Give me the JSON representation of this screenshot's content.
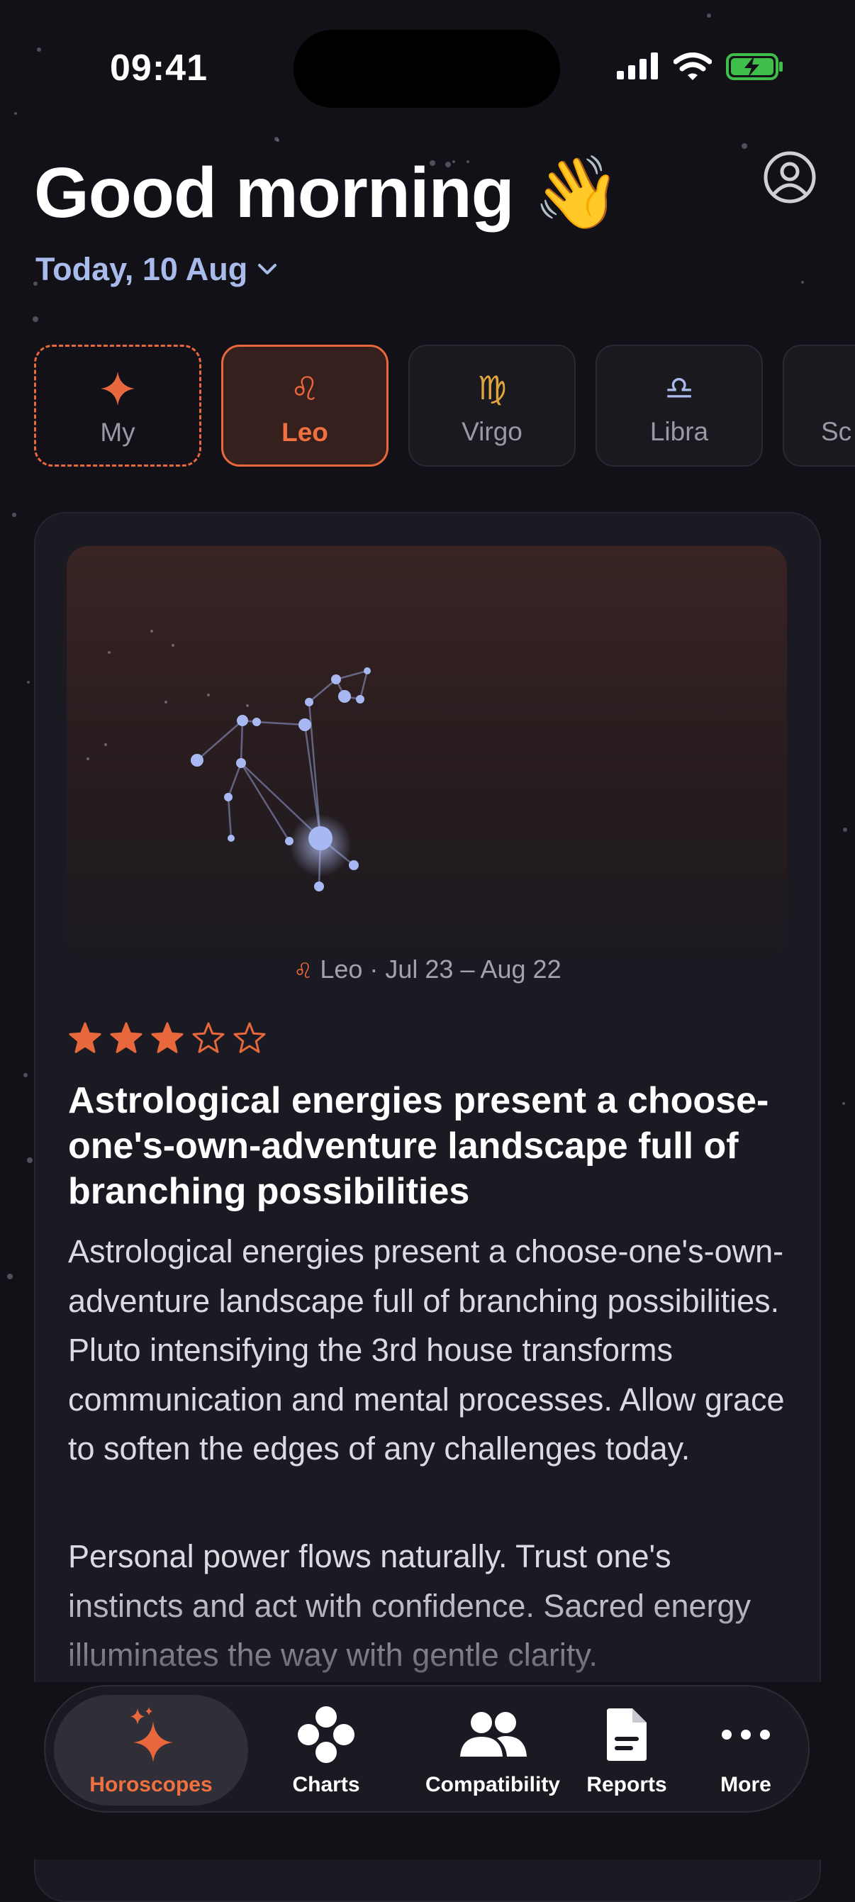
{
  "status": {
    "time": "09:41"
  },
  "header": {
    "greeting": "Good morning 👋",
    "date": "Today, 10 Aug"
  },
  "signs": [
    {
      "label": "My",
      "icon": "sparkle-icon"
    },
    {
      "label": "Leo",
      "glyph": "♌︎",
      "active": true
    },
    {
      "label": "Virgo",
      "glyph": "♍︎"
    },
    {
      "label": "Libra",
      "glyph": "♎︎"
    },
    {
      "label": "Sc"
    }
  ],
  "card": {
    "sign_glyph": "♌︎",
    "sign_dates": "Leo · Jul 23 – Aug 22",
    "rating": {
      "value": 3,
      "max": 5
    },
    "headline": "Astrological energies present a choose-one's-own-adventure landscape full of branching possibilities",
    "paragraphs": [
      "Astrological energies present a choose-one's-own-adventure landscape full of branching possibilities. Pluto intensifying the 3rd house transforms communication and mental processes. Allow grace to soften the edges of any challenges today.",
      "Personal power flows naturally. Trust one's instincts and act with confidence. Sacred energy illuminates the way with gentle clarity."
    ]
  },
  "nav": [
    {
      "label": "Horoscopes",
      "icon": "sparkles-icon",
      "active": true
    },
    {
      "label": "Charts",
      "icon": "charts-icon"
    },
    {
      "label": "Compatibility",
      "icon": "people-icon"
    },
    {
      "label": "Reports",
      "icon": "document-icon"
    },
    {
      "label": "More",
      "icon": "ellipsis-icon"
    }
  ],
  "colors": {
    "accent": "#e8673c",
    "background": "#121118",
    "card": "#1b1a22",
    "date_text": "#a9bbea",
    "virgo_glyph": "#e0a53e",
    "libra_glyph": "#a9bbea"
  }
}
